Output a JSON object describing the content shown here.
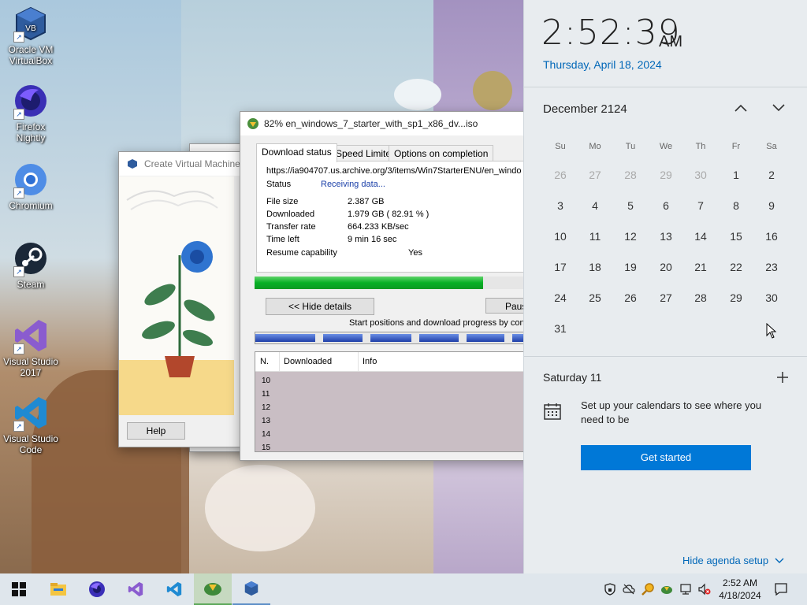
{
  "desktop": {
    "icons": [
      {
        "label": "Oracle VM VirtualBox",
        "icon": "virtualbox-icon"
      },
      {
        "label": "Firefox Nightly",
        "icon": "firefox-nightly-icon"
      },
      {
        "label": "Chromium",
        "icon": "chromium-icon"
      },
      {
        "label": "Steam",
        "icon": "steam-icon"
      },
      {
        "label": "Visual Studio 2017",
        "icon": "visual-studio-icon"
      },
      {
        "label": "Visual Studio Code",
        "icon": "vscode-icon"
      }
    ]
  },
  "vbox_wizard": {
    "title": "Create Virtual Machine",
    "help_label": "Help"
  },
  "idm": {
    "title": "82% en_windows_7_starter_with_sp1_x86_dv...iso",
    "tabs": [
      "Download status",
      "Speed Limiter",
      "Options on completion"
    ],
    "url": "https://ia904707.us.archive.org/3/items/Win7StarterENU/en_windo",
    "status_label": "Status",
    "status_value": "Receiving data...",
    "file_size_label": "File size",
    "file_size_value": "2.387  GB",
    "downloaded_label": "Downloaded",
    "downloaded_value": "1.979  GB  ( 82.91 % )",
    "transfer_rate_label": "Transfer rate",
    "transfer_rate_value": "664.233  KB/sec",
    "time_left_label": "Time left",
    "time_left_value": "9 min 16 sec",
    "resume_label": "Resume capability",
    "resume_value": "Yes",
    "progress_fraction": 0.8291,
    "hide_details_label": "<< Hide details",
    "pause_label": "Paus",
    "start_positions_text": "Start positions and download progress by con",
    "table_headers": [
      "N.",
      "Downloaded",
      "Info"
    ],
    "table_rows": [
      "10",
      "11",
      "12",
      "13",
      "14",
      "15"
    ]
  },
  "action_center": {
    "time": "2:52:39",
    "ampm": "AM",
    "date": "Thursday, April 18, 2024",
    "month_label": "December 2124",
    "weekdays": [
      "Su",
      "Mo",
      "Tu",
      "We",
      "Th",
      "Fr",
      "Sa"
    ],
    "weeks": [
      [
        "26",
        "27",
        "28",
        "29",
        "30",
        "1",
        "2"
      ],
      [
        "3",
        "4",
        "5",
        "6",
        "7",
        "8",
        "9"
      ],
      [
        "10",
        "11",
        "12",
        "13",
        "14",
        "15",
        "16"
      ],
      [
        "17",
        "18",
        "19",
        "20",
        "21",
        "22",
        "23"
      ],
      [
        "24",
        "25",
        "26",
        "27",
        "28",
        "29",
        "30"
      ],
      [
        "31"
      ]
    ],
    "agenda_day": "Saturday 11",
    "agenda_message": "Set up your calendars to see where you need to be",
    "get_started_label": "Get started",
    "hide_agenda_label": "Hide agenda setup",
    "accent_color": "#0078d7"
  },
  "taskbar": {
    "apps": [
      "file-explorer-icon",
      "firefox-icon",
      "visual-studio-icon",
      "vscode-icon",
      "idm-icon",
      "virtualbox-icon"
    ],
    "clock_time": "2:52 AM",
    "clock_date": "4/18/2024"
  }
}
